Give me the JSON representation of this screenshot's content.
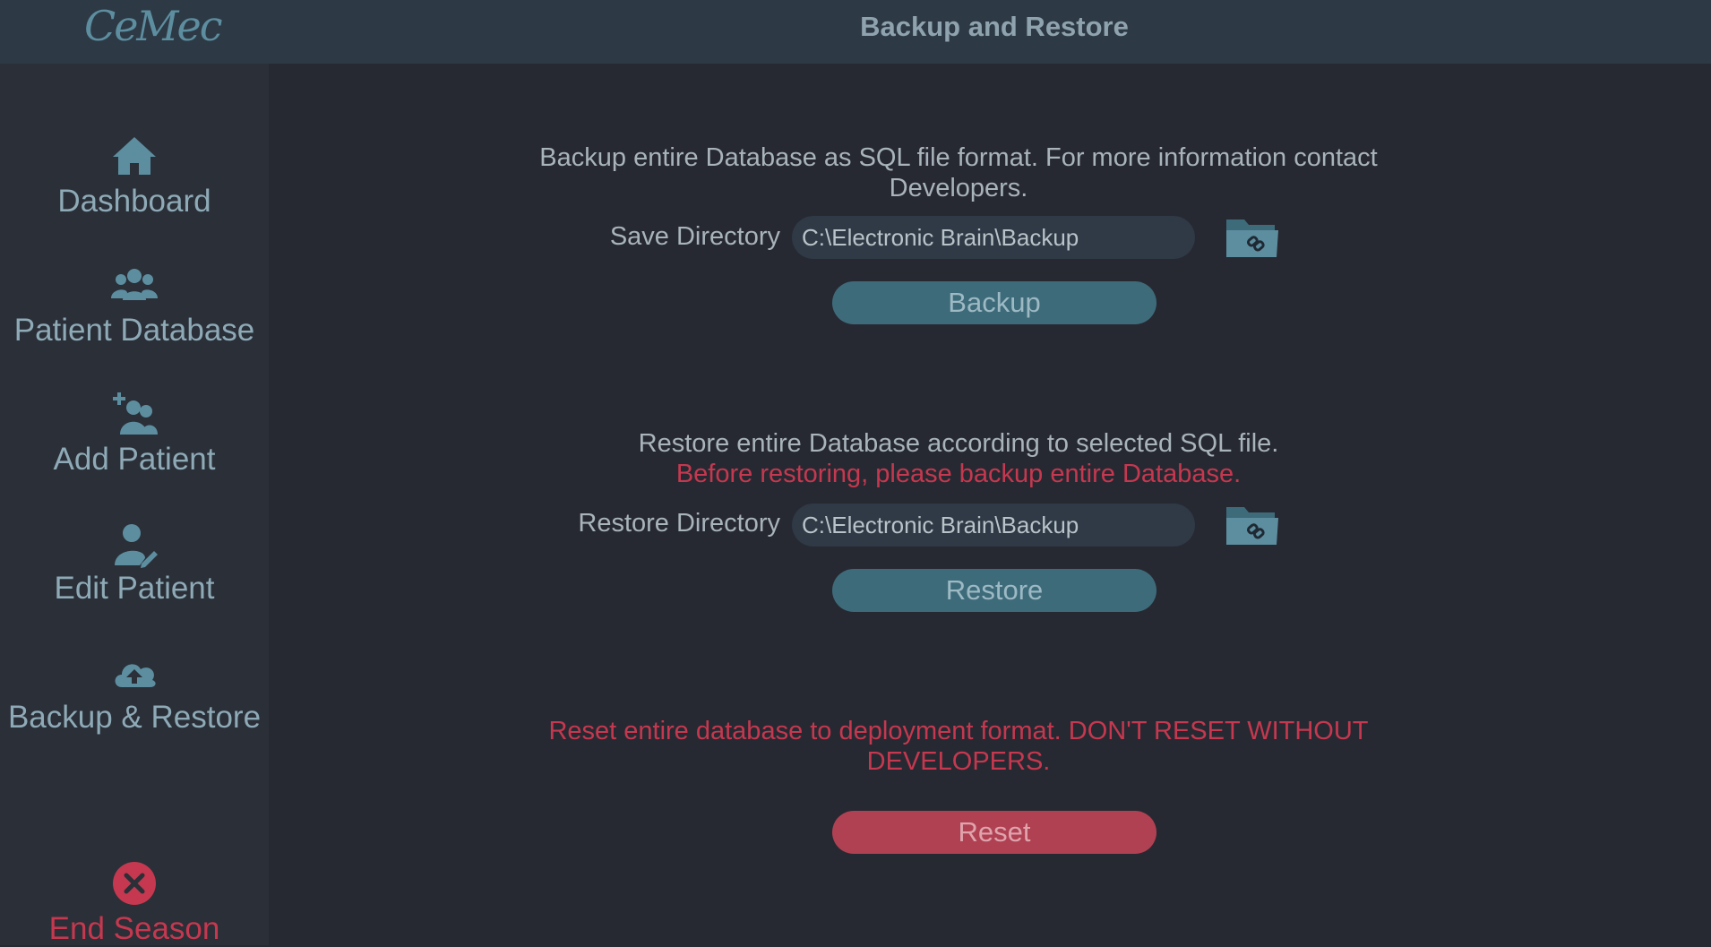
{
  "header": {
    "logo": "CeMec",
    "title": "Backup and Restore"
  },
  "sidebar": {
    "items": [
      {
        "label": "Dashboard",
        "icon": "home-icon"
      },
      {
        "label": "Patient Database",
        "icon": "users-icon"
      },
      {
        "label": "Add Patient",
        "icon": "add-user-icon"
      },
      {
        "label": "Edit Patient",
        "icon": "edit-user-icon"
      },
      {
        "label": "Backup & Restore",
        "icon": "cloud-upload-icon"
      }
    ],
    "end_session": {
      "label": "End Season",
      "icon": "close-circle-icon"
    }
  },
  "backup": {
    "description": "Backup entire Database as SQL file format. For more information contact Developers.",
    "dir_label": "Save Directory",
    "dir_value": "C:\\Electronic Brain\\Backup",
    "button_label": "Backup"
  },
  "restore": {
    "description": "Restore entire Database according to selected SQL file.",
    "warning": "Before restoring, please backup  entire Database.",
    "dir_label": "Restore Directory",
    "dir_value": "C:\\Electronic Brain\\Backup",
    "button_label": "Restore"
  },
  "reset": {
    "warning": "Reset entire database to deployment format. DON'T RESET WITHOUT DEVELOPERS.",
    "button_label": "Reset"
  },
  "colors": {
    "accent": "#3e6b7a",
    "danger": "#c5384f",
    "icon": "#5d8ea0"
  }
}
